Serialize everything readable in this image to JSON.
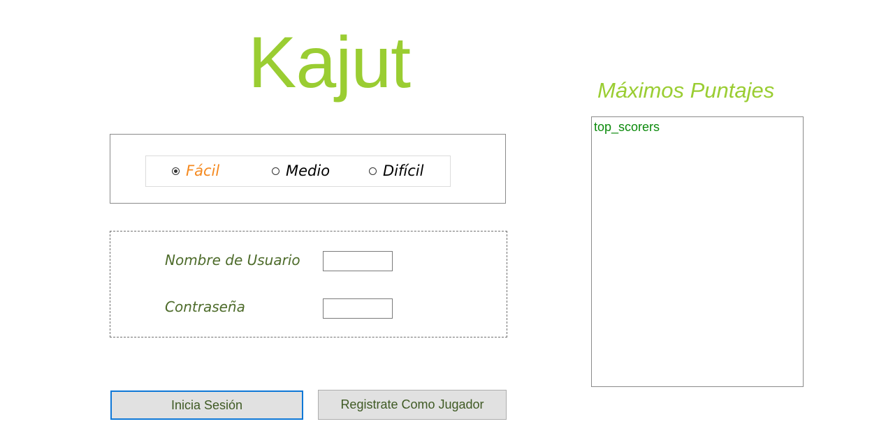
{
  "app": {
    "title": "Kajut"
  },
  "difficulty": {
    "options": [
      {
        "label": "Fácil",
        "selected": true
      },
      {
        "label": "Medio",
        "selected": false
      },
      {
        "label": "Difícil",
        "selected": false
      }
    ]
  },
  "login": {
    "username_label": "Nombre de Usuario",
    "username_value": "",
    "password_label": "Contraseña",
    "password_value": ""
  },
  "buttons": {
    "login_label": "Inicia Sesión",
    "register_label": "Registrate Como Jugador"
  },
  "scores": {
    "title": "Máximos Puntajes",
    "content": "top_scorers"
  },
  "colors": {
    "title_green": "#9acd32",
    "label_dark_green": "#4d6b2a",
    "selected_orange": "#f5891f",
    "focus_blue": "#0f78d7",
    "scores_text_green": "#0c8a0c"
  }
}
